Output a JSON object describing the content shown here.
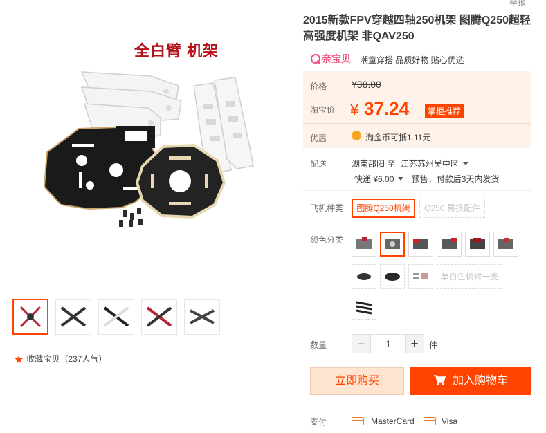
{
  "report_link": "举报",
  "product": {
    "title": "2015新款FPV穿越四轴250机架 图腾Q250超轻高强度机架 非QAV250",
    "image_caption": "全白臂 机架"
  },
  "brand": {
    "logo_text": "亲宝贝",
    "slogan": "潮童穿搭 品质好物 贴心优选",
    "accent": "#ff4400"
  },
  "price": {
    "original_label": "价格",
    "original_value": "¥38.00",
    "promo_label": "淘宝价",
    "promo_currency": "¥",
    "promo_value": "37.24",
    "promo_tag": "掌柜推荐",
    "benefit_label": "优惠",
    "benefit_text": "淘金币可抵",
    "benefit_amount": "1.11元"
  },
  "shipping": {
    "label": "配送",
    "from": "湖南邵阳",
    "to_word": "至",
    "destination": "江苏苏州吴中区",
    "method": "快递 ¥6.00",
    "note": "预售，付款后3天内发货"
  },
  "options": {
    "frame_label": "飞机种类",
    "frame_choices": [
      "图腾Q250机架",
      "Q250 易损配件"
    ],
    "color_label": "颜色分类",
    "color_text_choice": "单白色机臂一支"
  },
  "quantity": {
    "label": "数量",
    "value": "1",
    "minus": "−",
    "plus": "+",
    "unit": "件"
  },
  "actions": {
    "buy_now": "立即购买",
    "add_to_cart": "加入购物车"
  },
  "payment": {
    "label": "支付",
    "methods": [
      "MasterCard",
      "Visa"
    ]
  },
  "favorite": {
    "text": "收藏宝贝",
    "count": "（237人气）"
  }
}
